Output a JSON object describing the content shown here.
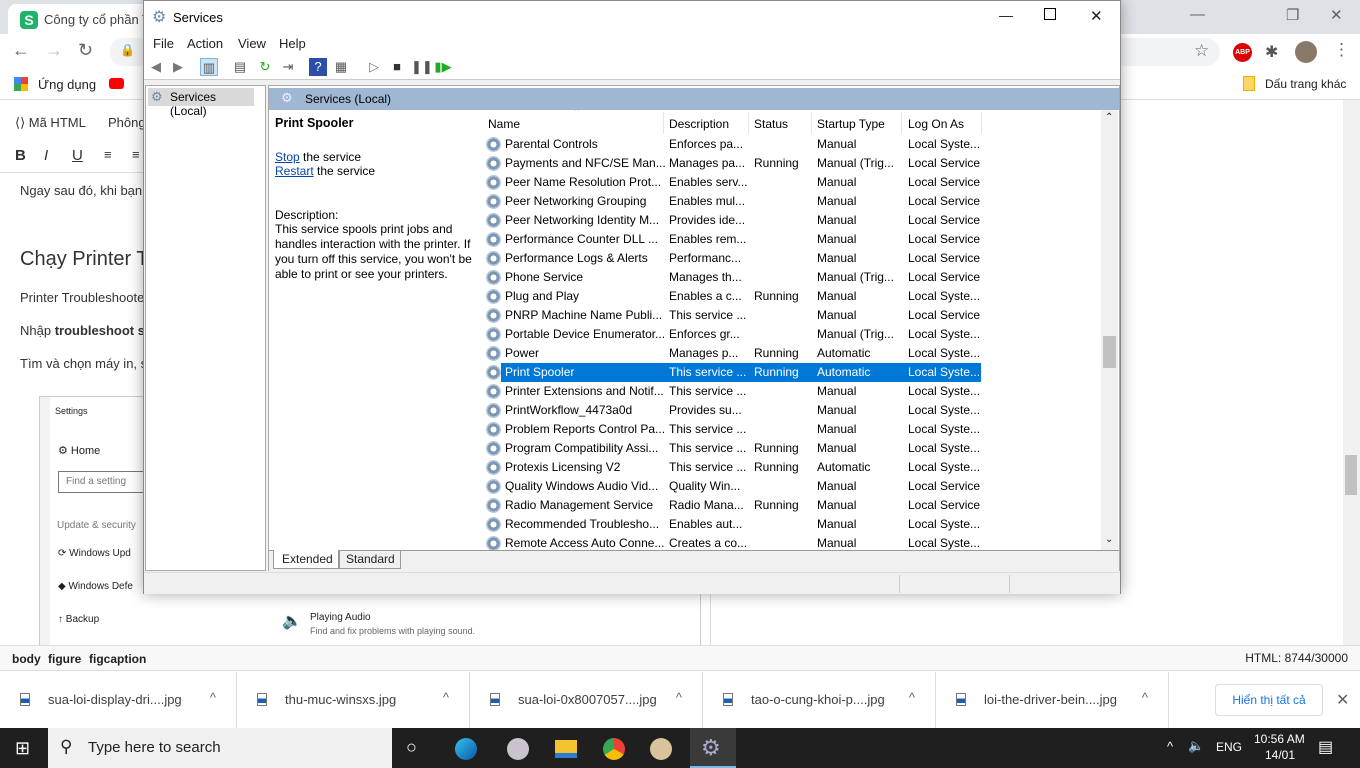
{
  "browser": {
    "tab_title": "Công ty cổ phần Tầ",
    "bookmarks": {
      "apps": "Ứng dụng",
      "other": "Dấu trang khác"
    },
    "extension_abp": "ABP"
  },
  "editor": {
    "toolbar": {
      "html_label": "Mã HTML",
      "font_label": "Phông",
      "bold": "B",
      "italic": "I",
      "underline": "U"
    },
    "content": {
      "p1": "Ngay sau đó, khi bạn",
      "heading": "Chạy Printer T",
      "p2": "Printer Troubleshoote",
      "p3_prefix": "Nhập ",
      "p3_bold": "troubleshoot s",
      "p4": "Tìm và chọn máy in, s"
    },
    "figure": {
      "title": "Settings",
      "home": "Home",
      "search_placeholder": "Find a setting",
      "section": "Update & security",
      "items": [
        "Windows Upd",
        "Windows Defe",
        "Backup"
      ],
      "audio_title": "Playing Audio",
      "audio_desc": "Find and fix problems with playing sound."
    },
    "status_path": [
      "body",
      "figure",
      "figcaption"
    ],
    "html_count": "HTML: 8744/30000"
  },
  "downloads": {
    "items": [
      "sua-loi-display-dri....jpg",
      "thu-muc-winsxs.jpg",
      "sua-loi-0x8007057....jpg",
      "tao-o-cung-khoi-p....jpg",
      "loi-the-driver-bein....jpg"
    ],
    "show_all": "Hiển thị tất cả"
  },
  "taskbar": {
    "search_placeholder": "Type here to search",
    "lang": "ENG",
    "time": "10:56 AM",
    "date": "14/01"
  },
  "services": {
    "window_title": "Services",
    "menu": [
      "File",
      "Action",
      "View",
      "Help"
    ],
    "tree_item": "Services (Local)",
    "header": "Services (Local)",
    "selected_name": "Print Spooler",
    "stop_link": "Stop",
    "stop_suffix": " the service",
    "restart_link": "Restart",
    "restart_suffix": " the service",
    "description_label": "Description:",
    "description": "This service spools print jobs and handles interaction with the printer. If you turn off this service, you won't be able to print or see your printers.",
    "columns": [
      "Name",
      "Description",
      "Status",
      "Startup Type",
      "Log On As"
    ],
    "selected_index": 12,
    "rows": [
      [
        "Parental Controls",
        "Enforces pa...",
        "",
        "Manual",
        "Local Syste..."
      ],
      [
        "Payments and NFC/SE Man...",
        "Manages pa...",
        "Running",
        "Manual (Trig...",
        "Local Service"
      ],
      [
        "Peer Name Resolution Prot...",
        "Enables serv...",
        "",
        "Manual",
        "Local Service"
      ],
      [
        "Peer Networking Grouping",
        "Enables mul...",
        "",
        "Manual",
        "Local Service"
      ],
      [
        "Peer Networking Identity M...",
        "Provides ide...",
        "",
        "Manual",
        "Local Service"
      ],
      [
        "Performance Counter DLL ...",
        "Enables rem...",
        "",
        "Manual",
        "Local Service"
      ],
      [
        "Performance Logs & Alerts",
        "Performanc...",
        "",
        "Manual",
        "Local Service"
      ],
      [
        "Phone Service",
        "Manages th...",
        "",
        "Manual (Trig...",
        "Local Service"
      ],
      [
        "Plug and Play",
        "Enables a c...",
        "Running",
        "Manual",
        "Local Syste..."
      ],
      [
        "PNRP Machine Name Publi...",
        "This service ...",
        "",
        "Manual",
        "Local Service"
      ],
      [
        "Portable Device Enumerator...",
        "Enforces gr...",
        "",
        "Manual (Trig...",
        "Local Syste..."
      ],
      [
        "Power",
        "Manages p...",
        "Running",
        "Automatic",
        "Local Syste..."
      ],
      [
        "Print Spooler",
        "This service ...",
        "Running",
        "Automatic",
        "Local Syste..."
      ],
      [
        "Printer Extensions and Notif...",
        "This service ...",
        "",
        "Manual",
        "Local Syste..."
      ],
      [
        "PrintWorkflow_4473a0d",
        "Provides su...",
        "",
        "Manual",
        "Local Syste..."
      ],
      [
        "Problem Reports Control Pa...",
        "This service ...",
        "",
        "Manual",
        "Local Syste..."
      ],
      [
        "Program Compatibility Assi...",
        "This service ...",
        "Running",
        "Manual",
        "Local Syste..."
      ],
      [
        "Protexis Licensing V2",
        "This service ...",
        "Running",
        "Automatic",
        "Local Syste..."
      ],
      [
        "Quality Windows Audio Vid...",
        "Quality Win...",
        "",
        "Manual",
        "Local Service"
      ],
      [
        "Radio Management Service",
        "Radio Mana...",
        "Running",
        "Manual",
        "Local Service"
      ],
      [
        "Recommended Troublesho...",
        "Enables aut...",
        "",
        "Manual",
        "Local Syste..."
      ],
      [
        "Remote Access Auto Conne...",
        "Creates a co...",
        "",
        "Manual",
        "Local Syste..."
      ]
    ],
    "tabs": [
      "Extended",
      "Standard"
    ],
    "active_tab": "Extended",
    "selection_color": "#0078d7"
  }
}
